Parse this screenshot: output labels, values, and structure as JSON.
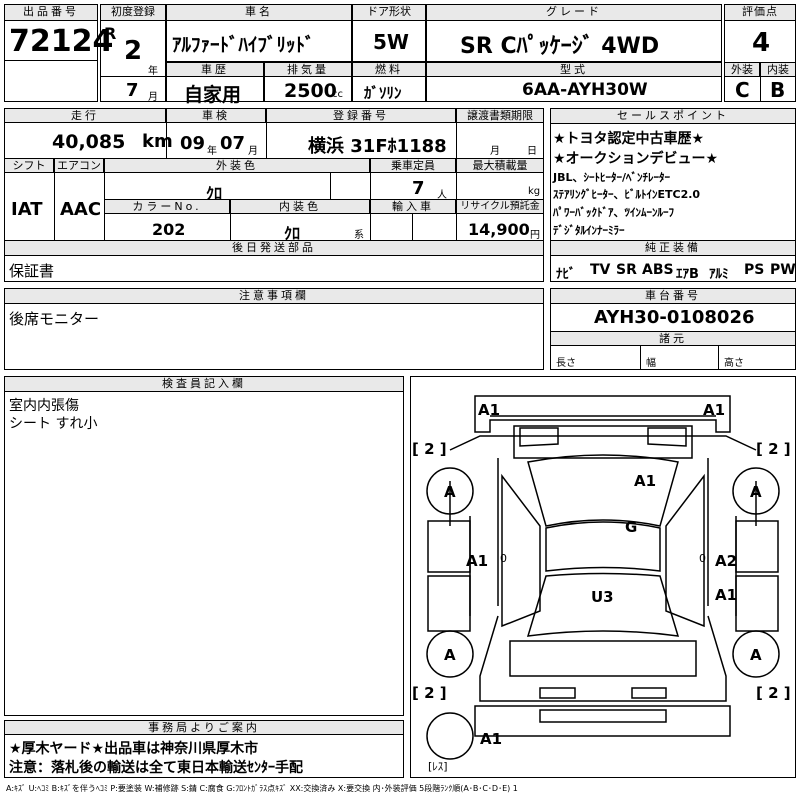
{
  "top": {
    "lot_label": "出品番号",
    "lot_number": "72124",
    "first_reg_label": "初度登録",
    "era": "R",
    "year": "2",
    "year_unit": "年",
    "month": "7",
    "month_unit": "月",
    "car_name_label": "車名",
    "car_name": "ｱﾙﾌｧｰﾄﾞﾊｲﾌﾞﾘｯﾄﾞ",
    "door_label": "ドア形状",
    "door": "5W",
    "grade_label": "グレード",
    "grade": "SR Cﾊﾟｯｹｰｼﾞ 4WD",
    "score_label": "評価点",
    "score": "4",
    "history_label": "車歴",
    "history": "自家用",
    "displacement_label": "排気量",
    "displacement": "2500",
    "cc": "cc",
    "fuel_label": "燃料",
    "fuel": "ｶﾞｿﾘﾝ",
    "model_label": "型式",
    "model": "6AA-AYH30W",
    "exterior_label": "外装",
    "exterior": "C",
    "interior_label": "内装",
    "interior": "B"
  },
  "mid": {
    "mileage_label": "走行",
    "mileage": "40,085",
    "km": "km",
    "inspection_label": "車検",
    "insp_year": "09",
    "insp_year_unit": "年",
    "insp_month": "07",
    "insp_month_unit": "月",
    "plate_label": "登録番号",
    "plate": "横浜 31Fﾎ1188",
    "transfer_label": "譲渡書類期限",
    "transfer_month": "月",
    "transfer_day": "日",
    "shift_label": "シフト",
    "shift": "IAT",
    "ac_label": "エアコン",
    "ac": "AAC",
    "ext_color_label": "外装色",
    "ext_color": "ｸﾛ",
    "capacity_label": "乗車定員",
    "capacity": "7",
    "capacity_unit": "人",
    "load_label": "最大積載量",
    "load_unit": "kg",
    "color_no_label": "カラーNo.",
    "color_no": "202",
    "int_color_label": "内装色",
    "int_color": "ｸﾛ",
    "int_color_unit": "系",
    "import_label": "輸入車",
    "recycle_label": "リサイクル預託金",
    "recycle": "14,900",
    "recycle_unit": "円",
    "later_parts_label": "後日発送部品",
    "later_parts": "保証書"
  },
  "sales": {
    "label": "セールスポイント",
    "lines": [
      "★トヨタ認定中古車歴★",
      "★オークションデビュー★",
      "JBL、ｼｰﾄﾋｰﾀｰ/ﾍﾞﾝﾁﾚｰﾀｰ",
      "ｽﾃｱﾘﾝｸﾞﾋｰﾀｰ、ﾋﾞﾙﾄｲﾝETC2.0",
      "ﾊﾟﾜｰﾊﾞｯｸﾄﾞｱ、ﾂｲﾝﾑｰﾝﾙｰﾌ",
      "ﾃﾞｼﾞﾀﾙｲﾝﾅｰﾐﾗｰ"
    ]
  },
  "equipment": {
    "label": "純正装備",
    "items": [
      "ﾅﾋﾞ",
      "TV",
      "SR",
      "ABS",
      "ｴｱB",
      "ｱﾙﾐ",
      "PS",
      "PW"
    ]
  },
  "notes": {
    "label": "注意事項欄",
    "text": "後席モニター"
  },
  "chassis": {
    "label": "車台番号",
    "number": "AYH30-0108026",
    "dims_label": "諸元",
    "length": "長さ",
    "width": "幅",
    "height": "高さ"
  },
  "inspector": {
    "label": "検査員記入欄",
    "lines": [
      "室内内張傷",
      "シート すれ小"
    ]
  },
  "office": {
    "label": "事務局よりご案内",
    "line1": "★厚木ヤード★出品車は神奈川県厚木市",
    "line2": "注意：落札後の輸送は全て東日本輸送ｾﾝﾀｰ手配"
  },
  "diagram": {
    "marks": {
      "front_left": "A1",
      "front_right": "A1",
      "hood": "A1",
      "roof": "G",
      "left_mid": "A1",
      "right_mid": "A2",
      "right_rear": "A1",
      "center_rear": "U3",
      "rear": "A1",
      "wheel_fl": "A",
      "wheel_fr": "A",
      "wheel_rl": "A",
      "wheel_rr": "A",
      "tire_fl": "[ 2 ]",
      "tire_fr": "[ 2 ]",
      "tire_rl": "[ 2 ]",
      "tire_rr": "[ 2 ]",
      "spare": "[ﾚｽ]",
      "zero1": "0",
      "zero2": "0"
    }
  },
  "legend": "A:ｷｽﾞ U:ﾍｺﾐ B:ｷｽﾞを伴うﾍｺﾐ P:要塗装 W:補修跡 S:錆 C:腐食 G:ﾌﾛﾝﾄｶﾞﾗｽ点ｷｽﾞ XX:交換済み X:要交換 内･外装評価 5段階ﾗﾝｸ順(A･B･C･D･E) 1"
}
